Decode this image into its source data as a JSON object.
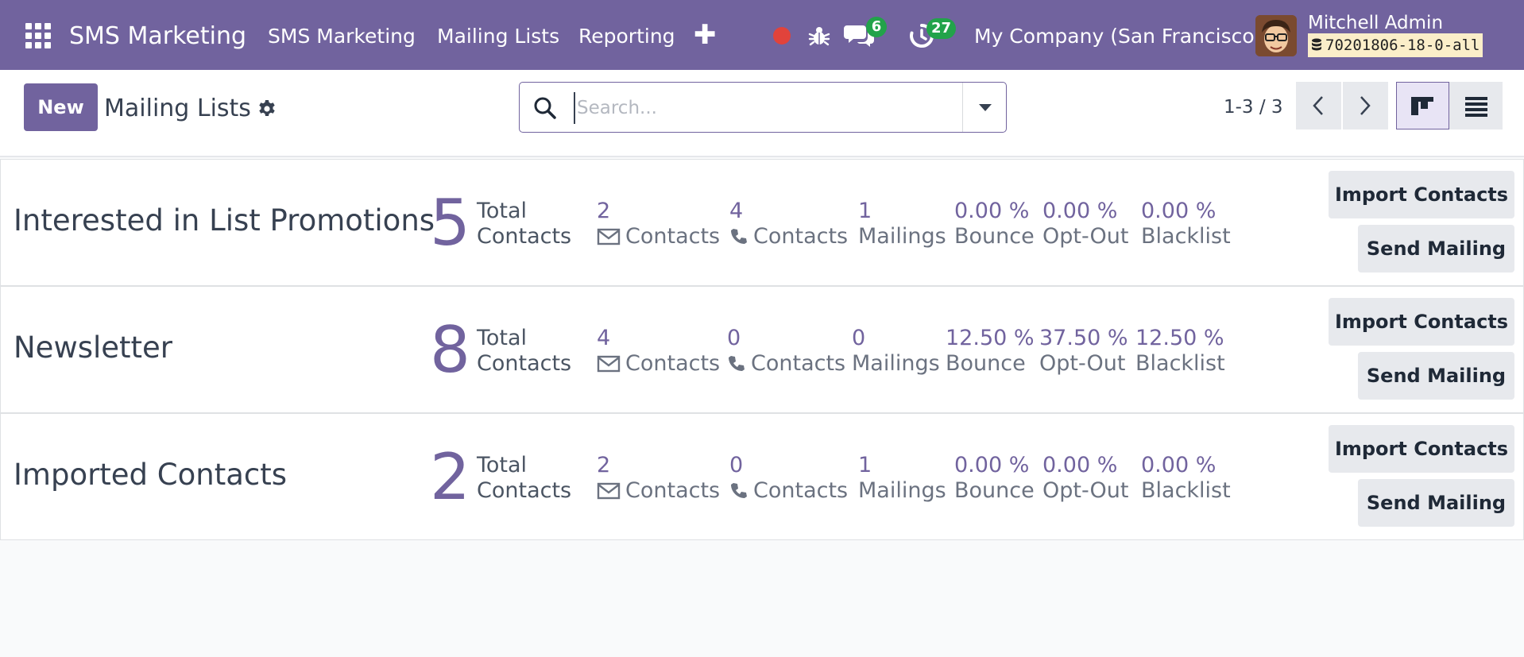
{
  "navbar": {
    "brand": "SMS Marketing",
    "menu": [
      "SMS Marketing",
      "Mailing Lists",
      "Reporting"
    ],
    "icons": [
      "apps-grid-icon",
      "plus-icon",
      "record-dot-icon",
      "bug-icon",
      "chat-icon",
      "activity-clock-icon",
      "database-icon"
    ],
    "messages_count": "6",
    "activities_count": "27",
    "company": "My Company (San Francisco)",
    "user_name": "Mitchell Admin",
    "database": "70201806-18-0-all",
    "colors": {
      "navbar_bg": "#71639e",
      "badge": "#22a34a",
      "record_dot": "#e1433b",
      "db_bg": "#fbeec9"
    }
  },
  "control": {
    "new_label": "New",
    "breadcrumb": "Mailing Lists",
    "search_placeholder": "Search...",
    "pager": "1-3 / 3"
  },
  "lists": [
    {
      "name": "Interested in List Promotions",
      "total": "5",
      "total_label_1": "Total",
      "total_label_2": "Contacts",
      "email_contacts": "2",
      "email_label": "Contacts",
      "sms_contacts": "4",
      "sms_label": "Contacts",
      "mailings": "1",
      "mailings_label": "Mailings",
      "bounce": "0.00 %",
      "bounce_label": "Bounce",
      "optout": "0.00 %",
      "optout_label": "Opt-Out",
      "blacklist": "0.00 %",
      "blacklist_label": "Blacklist",
      "import_label": "Import Contacts",
      "send_label": "Send Mailing"
    },
    {
      "name": "Newsletter",
      "total": "8",
      "total_label_1": "Total",
      "total_label_2": "Contacts",
      "email_contacts": "4",
      "email_label": "Contacts",
      "sms_contacts": "0",
      "sms_label": "Contacts",
      "mailings": "0",
      "mailings_label": "Mailings",
      "bounce": "12.50 %",
      "bounce_label": "Bounce",
      "optout": "37.50 %",
      "optout_label": "Opt-Out",
      "blacklist": "12.50 %",
      "blacklist_label": "Blacklist",
      "import_label": "Import Contacts",
      "send_label": "Send Mailing"
    },
    {
      "name": "Imported Contacts",
      "total": "2",
      "total_label_1": "Total",
      "total_label_2": "Contacts",
      "email_contacts": "2",
      "email_label": "Contacts",
      "sms_contacts": "0",
      "sms_label": "Contacts",
      "mailings": "1",
      "mailings_label": "Mailings",
      "bounce": "0.00 %",
      "bounce_label": "Bounce",
      "optout": "0.00 %",
      "optout_label": "Opt-Out",
      "blacklist": "0.00 %",
      "blacklist_label": "Blacklist",
      "import_label": "Import Contacts",
      "send_label": "Send Mailing"
    }
  ]
}
